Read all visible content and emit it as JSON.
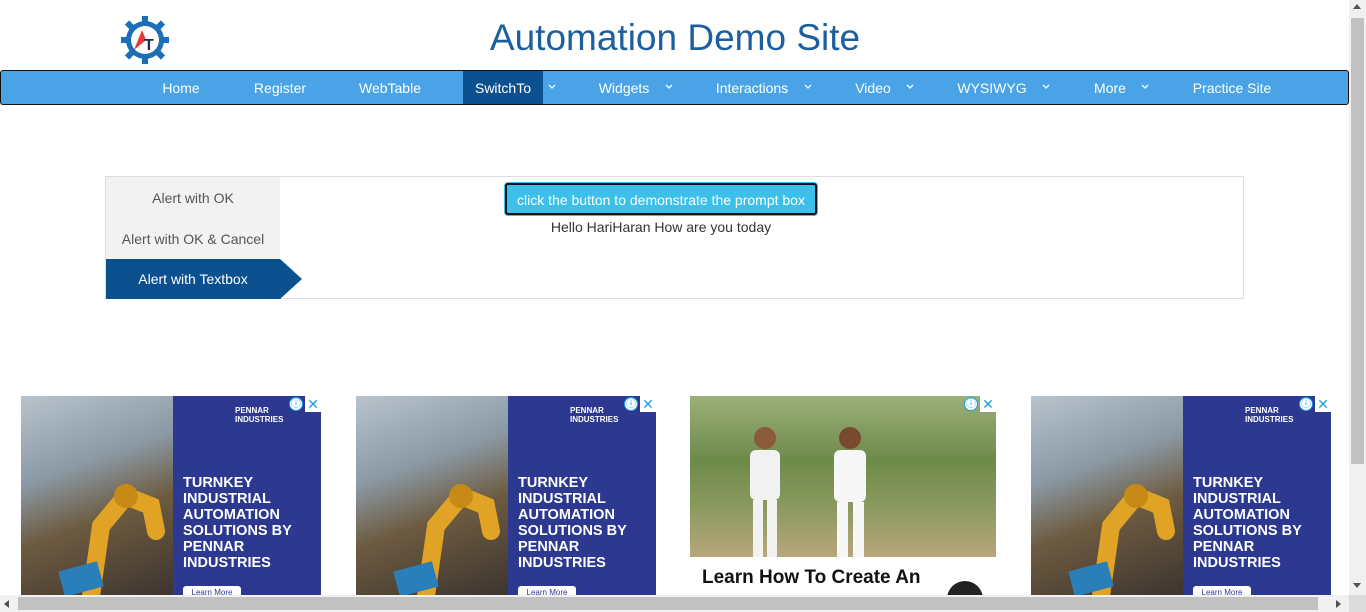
{
  "header": {
    "title": "Automation Demo Site"
  },
  "nav": {
    "items": [
      {
        "label": "Home"
      },
      {
        "label": "Register"
      },
      {
        "label": "WebTable"
      },
      {
        "label": "SwitchTo"
      },
      {
        "label": "Widgets"
      },
      {
        "label": "Interactions"
      },
      {
        "label": "Video"
      },
      {
        "label": "WYSIWYG"
      },
      {
        "label": "More"
      },
      {
        "label": "Practice Site"
      }
    ],
    "active": "SwitchTo"
  },
  "alerts": {
    "tabs": [
      {
        "label": "Alert with OK"
      },
      {
        "label": "Alert with OK & Cancel"
      },
      {
        "label": "Alert with Textbox"
      }
    ],
    "active_tab": "Alert with Textbox",
    "button_label": "click the button to demonstrate the prompt box",
    "result": "Hello HariHaran How are you today"
  },
  "ads": {
    "pennar": {
      "brand": "PENNAR INDUSTRIES",
      "headline": "TURNKEY INDUSTRIAL AUTOMATION SOLUTIONS BY PENNAR INDUSTRIES",
      "cta": "Learn More"
    },
    "third": {
      "headline": "Learn How To Create An"
    },
    "info_glyph": "ⓘ",
    "close_glyph": "✕"
  },
  "colors": {
    "title": "#1b5f9e",
    "navbar": "#4aa3e6",
    "nav_active": "#0b5190",
    "prompt_button": "#3cbfe8",
    "ad_blue": "#2d3991"
  }
}
